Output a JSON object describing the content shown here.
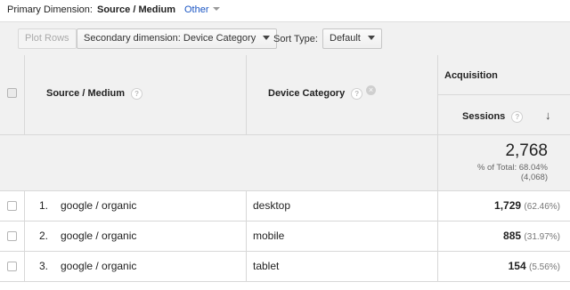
{
  "primary_dimension": {
    "label": "Primary Dimension:",
    "current": "Source / Medium",
    "other": "Other"
  },
  "toolbar": {
    "plot_rows": "Plot Rows",
    "secondary_dimension": "Secondary dimension: Device Category",
    "sort_type_label": "Sort Type:",
    "sort_type_value": "Default"
  },
  "table": {
    "columns": {
      "source_medium": "Source / Medium",
      "device_category": "Device Category",
      "acquisition": "Acquisition",
      "sessions": "Sessions"
    },
    "help_glyph": "?",
    "remove_glyph": "×",
    "sort_arrow": "↓",
    "totals": {
      "sessions": "2,768",
      "pct_line": "% of Total: 68.04%",
      "of_total": "(4,068)"
    },
    "rows": [
      {
        "index": "1.",
        "source": "google / organic",
        "device": "desktop",
        "sessions": "1,729",
        "pct": "(62.46%)"
      },
      {
        "index": "2.",
        "source": "google / organic",
        "device": "mobile",
        "sessions": "885",
        "pct": "(31.97%)"
      },
      {
        "index": "3.",
        "source": "google / organic",
        "device": "tablet",
        "sessions": "154",
        "pct": "(5.56%)"
      }
    ]
  }
}
